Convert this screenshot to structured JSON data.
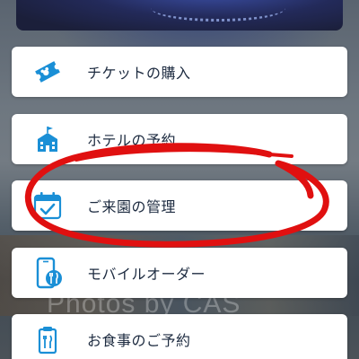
{
  "accent_color": "#1a8fd6",
  "annotation_color": "#e01010",
  "background_watermark": "Photos by CAS",
  "menu": {
    "items": [
      {
        "label": "チケットの購入",
        "icon": "ticket-icon"
      },
      {
        "label": "ホテルの予約",
        "icon": "hotel-icon"
      },
      {
        "label": "ご来園の管理",
        "icon": "calendar-check-icon"
      },
      {
        "label": "モバイルオーダー",
        "icon": "mobile-order-icon"
      },
      {
        "label": "お食事のご予約",
        "icon": "dining-reservation-icon"
      }
    ]
  }
}
